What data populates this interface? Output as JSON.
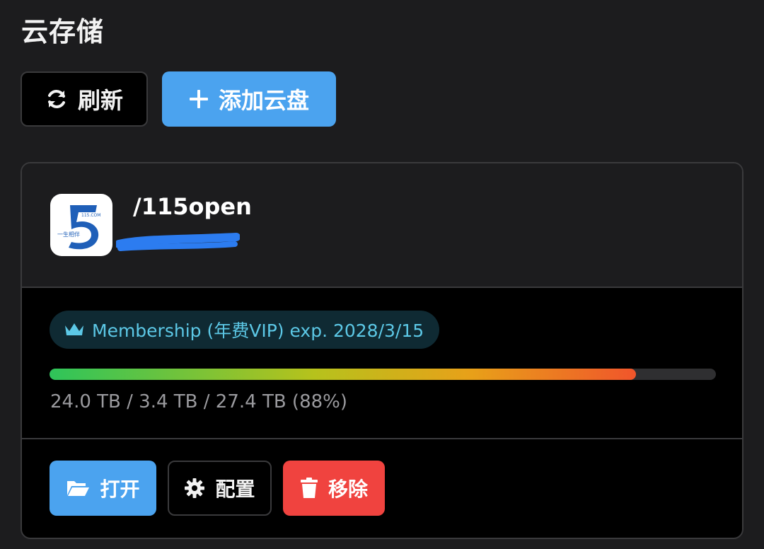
{
  "page": {
    "title": "云存储"
  },
  "toolbar": {
    "refresh_label": "刷新",
    "add_label": "添加云盘",
    "refresh_icon": "refresh-icon",
    "add_icon": "plus-icon"
  },
  "drive": {
    "name": "/115open",
    "logo_icon": "115-logo-icon",
    "membership": "Membership (年费VIP) exp. 2028/3/15",
    "usage_text": "24.0 TB / 3.4 TB / 27.4 TB (88%)",
    "usage_percent": 88
  },
  "actions": {
    "open_label": "打开",
    "config_label": "配置",
    "remove_label": "移除"
  },
  "colors": {
    "accent": "#4ba3ef",
    "danger": "#f0433f",
    "badge_text": "#5cc8e6",
    "background": "#1c1c1e"
  }
}
